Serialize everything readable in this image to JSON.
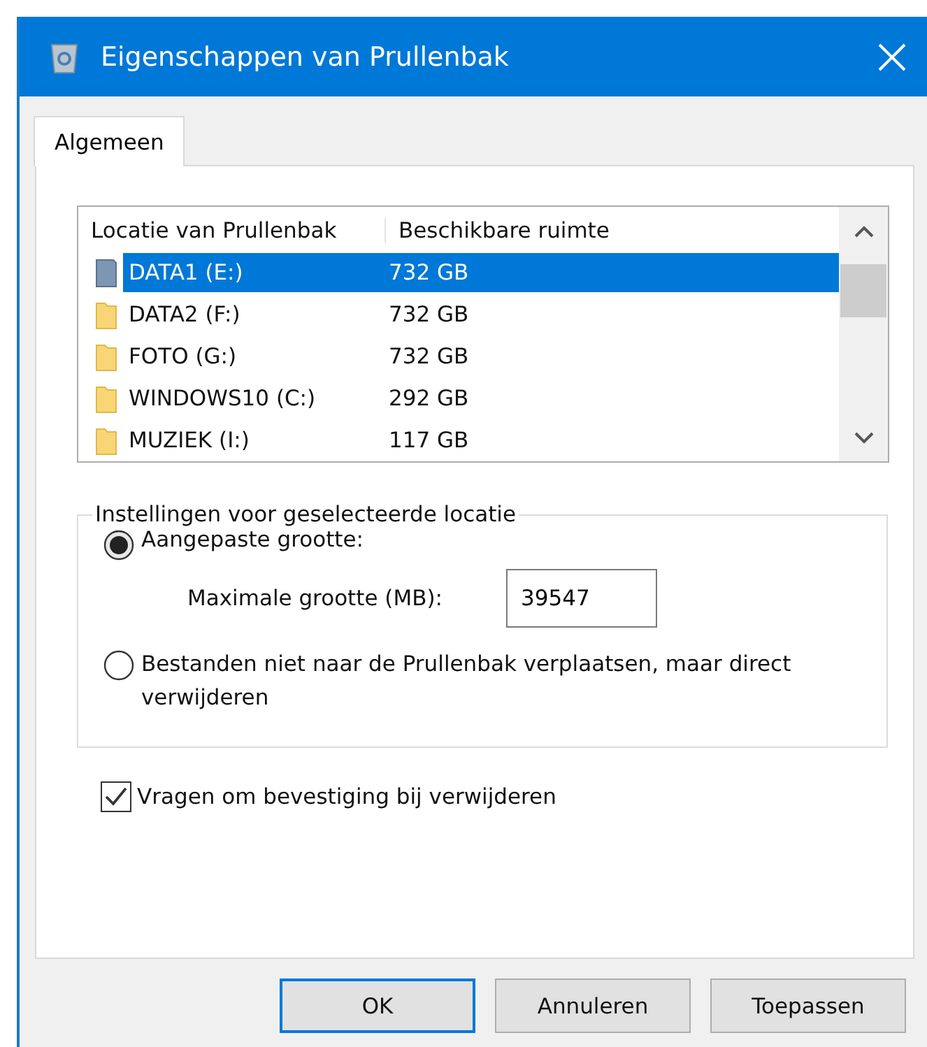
{
  "window": {
    "title": "Eigenschappen van Prullenbak"
  },
  "tabs": [
    {
      "label": "Algemeen",
      "selected": true
    }
  ],
  "locations": {
    "columns": [
      "Locatie van Prullenbak",
      "Beschikbare ruimte"
    ],
    "rows": [
      {
        "name": "DATA1 (E:)",
        "space": "732 GB",
        "selected": true,
        "kind": "drive"
      },
      {
        "name": "DATA2 (F:)",
        "space": "732 GB",
        "selected": false,
        "kind": "folder"
      },
      {
        "name": "FOTO (G:)",
        "space": "732 GB",
        "selected": false,
        "kind": "folder"
      },
      {
        "name": "WINDOWS10 (C:)",
        "space": "292 GB",
        "selected": false,
        "kind": "folder"
      },
      {
        "name": "MUZIEK (I:)",
        "space": "117 GB",
        "selected": false,
        "kind": "folder"
      }
    ]
  },
  "settings": {
    "legend": "Instellingen voor geselecteerde locatie",
    "options": [
      {
        "label": "Aangepaste grootte:",
        "selected": true
      },
      {
        "label": "Bestanden niet naar de Prullenbak verplaatsen, maar direct verwijderen",
        "selected": false
      }
    ],
    "max_size": {
      "label": "Maximale grootte (MB):",
      "value": "39547"
    }
  },
  "confirm": {
    "label": "Vragen om bevestiging bij verwijderen",
    "checked": true
  },
  "buttons": [
    {
      "label": "OK",
      "default": true
    },
    {
      "label": "Annuleren",
      "default": false
    },
    {
      "label": "Toepassen",
      "default": false
    }
  ]
}
